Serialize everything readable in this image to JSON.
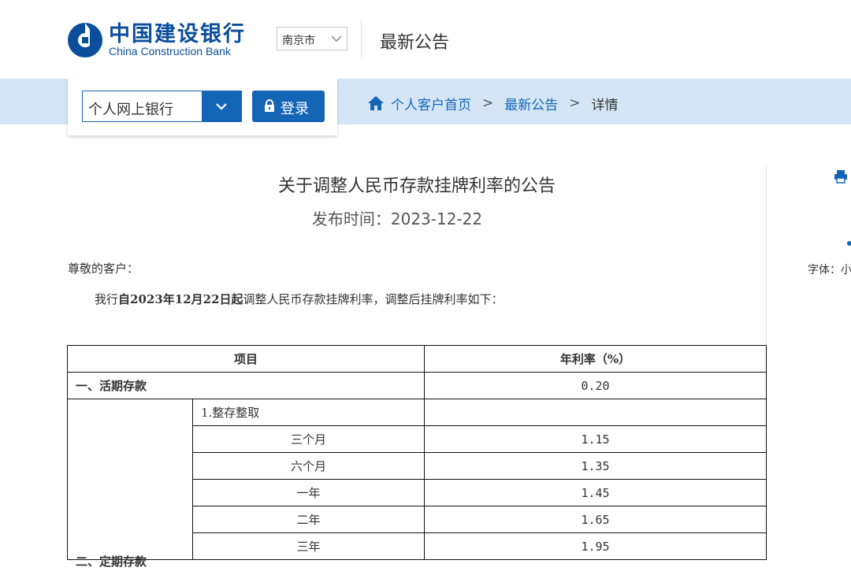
{
  "header": {
    "logo_cn": "中国建设银行",
    "logo_en": "China Construction Bank",
    "city": "南京市",
    "page_heading": "最新公告"
  },
  "login": {
    "bank_type": "个人网上银行",
    "login_label": "登录"
  },
  "breadcrumb": {
    "home": "个人客户首页",
    "sep": ">",
    "notices": "最新公告",
    "current": "详情"
  },
  "article": {
    "title": "关于调整人民币存款挂牌利率的公告",
    "date": "发布时间：2023-12-22",
    "greeting": "尊敬的客户：",
    "intro_pre": "我行",
    "intro_bold": "自2023年12月22日起",
    "intro_post": "调整人民币存款挂牌利率，调整后挂牌利率如下："
  },
  "sidebar": {
    "font_label": "字体：小"
  },
  "table": {
    "headers": [
      "项目",
      "年利率（%）"
    ],
    "demand": {
      "label": "一、活期存款",
      "rate": "0.20"
    },
    "fixed": {
      "label": "二、定期存款",
      "sub_head": "1.整存整取",
      "rows": [
        {
          "term": "三个月",
          "rate": "1.15"
        },
        {
          "term": "六个月",
          "rate": "1.35"
        },
        {
          "term": "一年",
          "rate": "1.45"
        },
        {
          "term": "二年",
          "rate": "1.65"
        },
        {
          "term": "三年",
          "rate": "1.95"
        }
      ]
    }
  },
  "colors": {
    "brand_blue": "#1565b7",
    "band_blue": "#d4e6f6",
    "logo_blue": "#0b4e9b"
  },
  "icons": [
    "ccb-logo-icon",
    "chevron-down-icon",
    "lock-icon",
    "home-icon",
    "print-icon"
  ]
}
